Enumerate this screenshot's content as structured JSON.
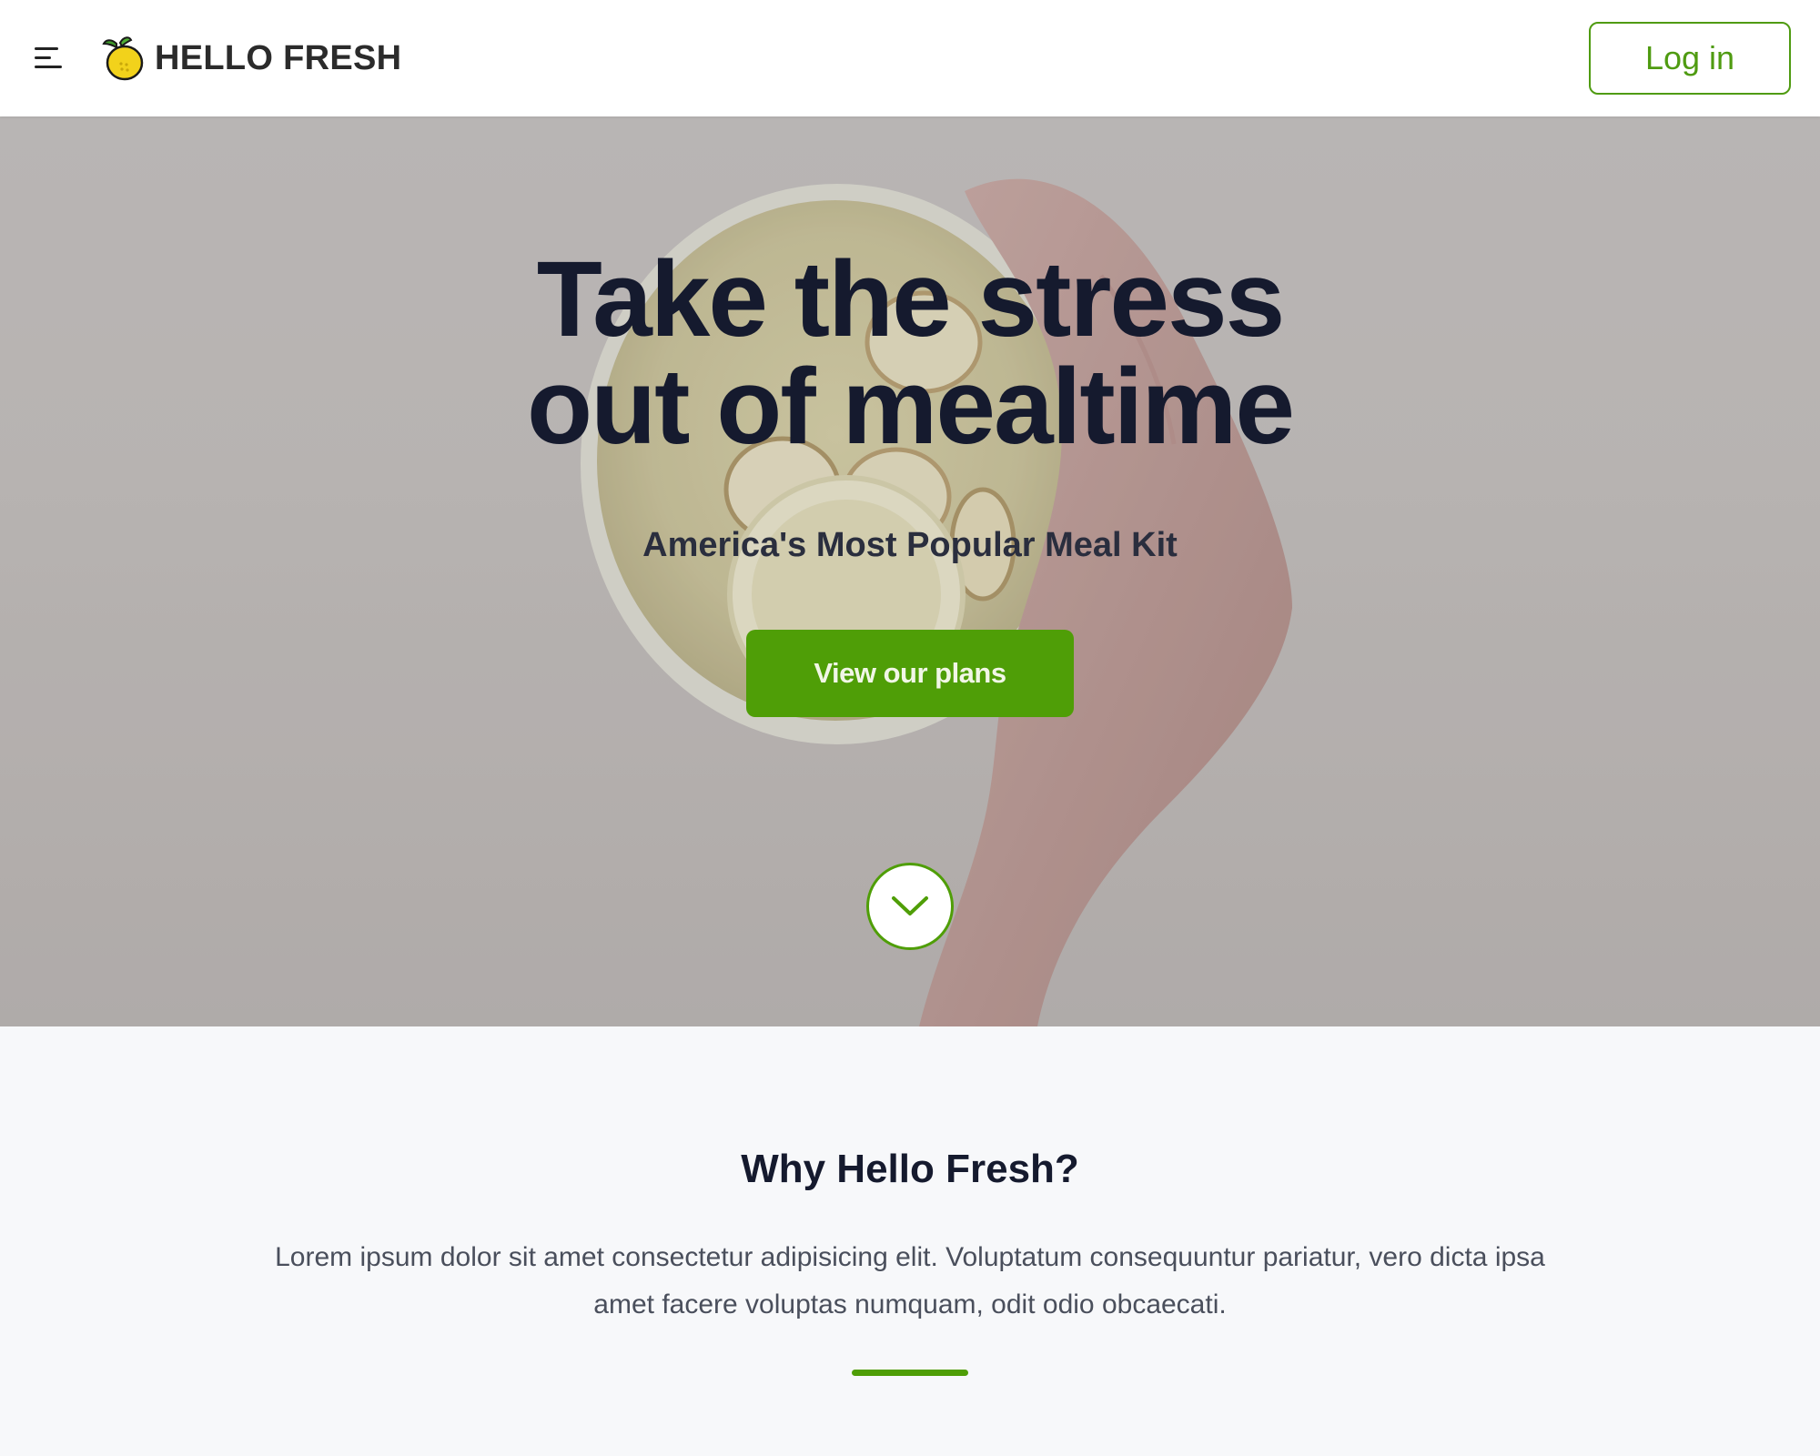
{
  "header": {
    "brand_name": "HELLO FRESH",
    "login_label": "Log in",
    "menu_icon": "hamburger-menu-icon",
    "logo_icon": "lemon-icon"
  },
  "hero": {
    "title_line1": "Take the stress",
    "title_line2": "out of mealtime",
    "subtitle": "America's Most Popular Meal Kit",
    "cta_label": "View our plans",
    "scroll_icon": "chevron-down-icon"
  },
  "why": {
    "title": "Why Hello Fresh?",
    "body": "Lorem ipsum dolor sit amet consectetur adipisicing elit. Voluptatum consequuntur pariatur, vero dicta ipsa amet facere voluptas numquam, odit odio obcaecati."
  },
  "colors": {
    "accent": "#4f9e07",
    "heading": "#151a2e",
    "body_text": "#4a4f5c",
    "header_bg": "#ffffff",
    "section_bg": "#f7f8fa"
  }
}
